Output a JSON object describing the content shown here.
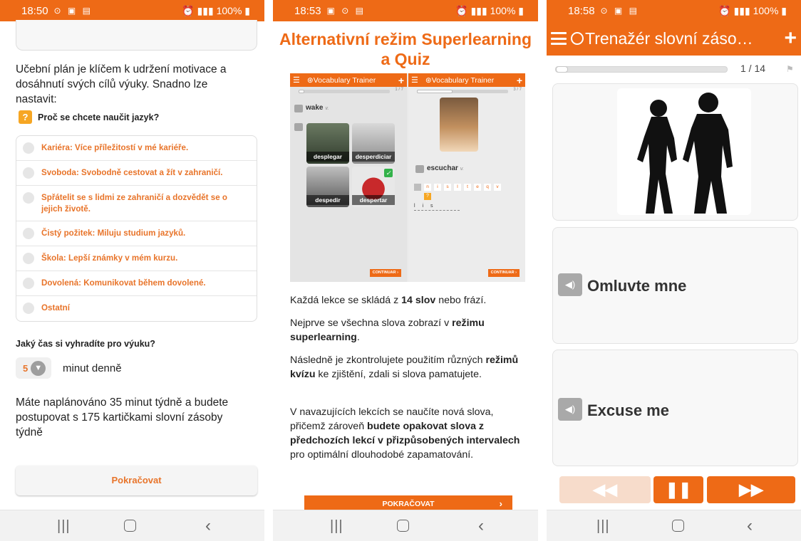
{
  "status": {
    "s1": {
      "time": "18:50",
      "battery": "100%"
    },
    "s2": {
      "time": "18:53",
      "battery": "100%"
    },
    "s3": {
      "time": "18:58",
      "battery": "100%"
    }
  },
  "screen1": {
    "intro": "Učební plán je klíčem k udržení motivace a dosáhnutí svých cílů výuky. Snadno lze nastavit:",
    "question_badge": "?",
    "question": "Proč se chcete naučit jazyk?",
    "options": [
      "Kariéra: Více příležitostí v mé kariéře.",
      "Svoboda: Svobodně cestovat a žít v zahraničí.",
      "Spřátelit se s lidmi ze zahraničí a dozvědět se o jejich životě.",
      "Čistý požitek: Miluju studium jazyků.",
      "Škola: Lepší známky v mém kurzu.",
      "Dovolená: Komunikovat během dovolené.",
      "Ostatní"
    ],
    "time_question": "Jaký čas si vyhradíte pro výuku?",
    "minutes_value": "5",
    "minutes_label": "minut denně",
    "plan_text": "Máte naplánováno  35  minut týdně a budete postupovat s  175  kartičkami slovní zásoby týdně",
    "continue_label": "Pokračovat"
  },
  "screen2": {
    "title": "Alternativní režim Superlearning a Quiz",
    "mock": {
      "app_title": "Vocabulary Trainer",
      "left_count": "1 / 7",
      "right_count": "3 / 7",
      "left_word": "wake",
      "left_pos": "v.",
      "tiles": [
        "desplegar",
        "desperdiciar",
        "despedir",
        "despertar"
      ],
      "right_word": "escuchar",
      "right_pos": "v.",
      "letters": [
        "n",
        "i",
        "s",
        "l",
        "t",
        "e",
        "q",
        "v"
      ],
      "hint": "?",
      "typed": "l i s",
      "continue": "CONTINUAR"
    },
    "p1_a": "Každá lekce se skládá z ",
    "p1_b": "14 slov",
    "p1_c": " nebo frází.",
    "p2_a": "Nejprve se všechna slova zobrazí v ",
    "p2_b": "režimu superlearning",
    "p2_c": ".",
    "p3_a": "Následně je zkontrolujete použitím různých ",
    "p3_b": "režimů kvízu",
    "p3_c": " ke zjištění, zdali si slova pamatujete.",
    "p4_a": "V navazujících lekcích se naučíte nová slova, přičemž zároveň ",
    "p4_b": "budete opakovat slova z předchozích lekcí v přizpůsobených intervalech",
    "p4_c": " pro optimální dlouhodobé zapamatování.",
    "continue_label": "POKRAČOVAT"
  },
  "screen3": {
    "title": "Trenažér slovní záso…",
    "counter": "1 / 14",
    "progress": 0.07,
    "phrase1": "Omluvte mne",
    "phrase2": "Excuse me"
  },
  "colors": {
    "accent": "#ee6a16",
    "option_text": "#e8742a",
    "badge": "#f6a623"
  }
}
